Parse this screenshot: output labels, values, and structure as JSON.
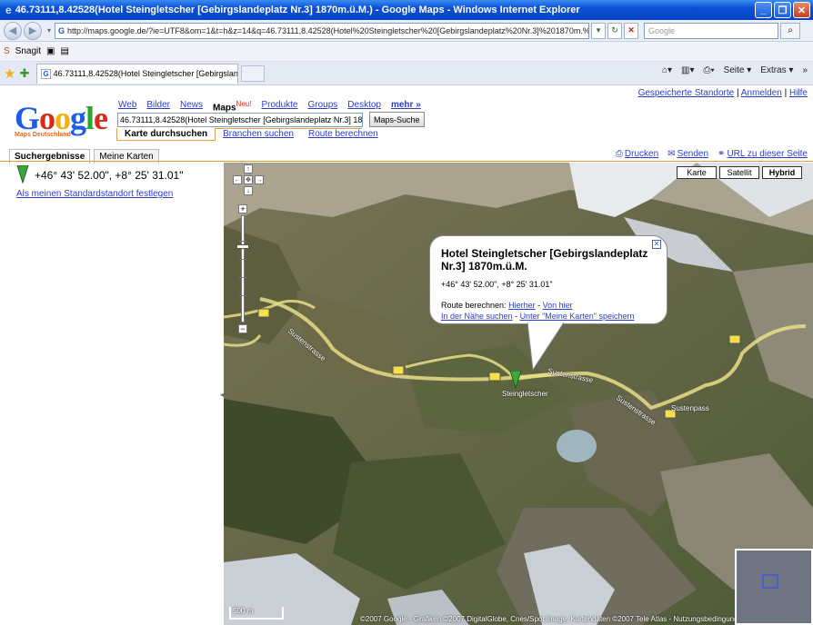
{
  "window": {
    "title": "46.73111,8.42528(Hotel Steingletscher [Gebirgslandeplatz Nr.3] 1870m.ü.M.) - Google Maps - Windows Internet Explorer",
    "url": "http://maps.google.de/?ie=UTF8&om=1&t=h&z=14&q=46.73111,8.42528(Hotel%20Steingletscher%20[Gebirgslandeplatz%20Nr.3]%201870m.%C3%BC.M.)",
    "search_placeholder": "Google",
    "links_bar": [
      "Snagit"
    ],
    "tab_title": "46.73111,8.42528(Hotel Steingletscher [Gebirgslande...",
    "cmd_page": "Seite",
    "cmd_extras": "Extras"
  },
  "google": {
    "top_links": {
      "saved": "Gespeicherte Standorte",
      "login": "Anmelden",
      "help": "Hilfe"
    },
    "logo_sub": "Maps Deutschland",
    "services": [
      {
        "label": "Web"
      },
      {
        "label": "Bilder"
      },
      {
        "label": "News"
      },
      {
        "label": "Maps",
        "badge": "Neu!"
      },
      {
        "label": "Produkte"
      },
      {
        "label": "Groups"
      },
      {
        "label": "Desktop"
      },
      {
        "label": "mehr »"
      }
    ],
    "query": "46.73111,8.42528(Hotel Steingletscher [Gebirgslandeplatz Nr.3] 187",
    "search_button": "Maps-Suche",
    "subtabs": [
      "Karte durchsuchen",
      "Branchen suchen",
      "Route berechnen"
    ]
  },
  "left_panel": {
    "tabs": [
      "Suchergebnisse",
      "Meine Karten"
    ],
    "result_coords": "+46° 43' 52.00\", +8° 25' 31.01\"",
    "set_default": "Als meinen Standardstandort festlegen"
  },
  "map_links": {
    "print": "Drucken",
    "send": "Senden",
    "url": "URL zu dieser Seite"
  },
  "map": {
    "type_buttons": [
      "Karte",
      "Satellit",
      "Hybrid"
    ],
    "selected_type": "Hybrid",
    "balloon": {
      "title": "Hotel Steingletscher [Gebirgslandeplatz Nr.3] 1870m.ü.M.",
      "coords": "+46° 43' 52.00\", +8° 25' 31.01\"",
      "route_label": "Route berechnen:",
      "to_here": "Hierher",
      "from_here": "Von hier",
      "nearby": "In der Nähe suchen",
      "save": "Unter \"Meine Karten\" speichern"
    },
    "labels": {
      "marker": "Steingletscher",
      "pass": "Sustenpass",
      "road": "Sustenstrasse",
      "road2": "Sustenstrasse",
      "road3": "Sustenstrasse",
      "route": "11"
    },
    "scale": "500 m",
    "copyright": "©2007 Google - Grafiken ©2007 DigitalGlobe, Cnes/Spot Image, Kartendaten ©2007 Tele Atlas - Nutzungsbedingungen"
  }
}
